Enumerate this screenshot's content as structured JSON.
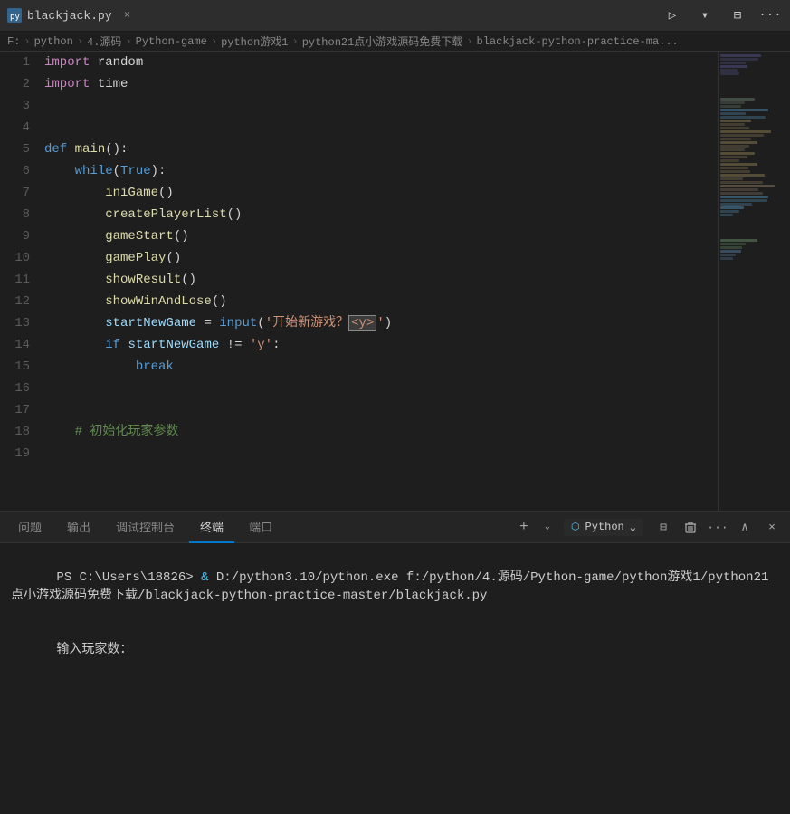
{
  "titleBar": {
    "tabName": "blackjack.py",
    "closeLabel": "×",
    "runBtn": "▷",
    "runDropdown": "▾",
    "splitBtn": "⊟",
    "moreBtn": "···"
  },
  "breadcrumb": {
    "parts": [
      "F:",
      "python",
      "4.源码",
      "Python-game",
      "python游戏1",
      "python21点小游戏源码免费下载",
      "blackjack-python-practice-ma..."
    ]
  },
  "codeLines": [
    {
      "num": "1",
      "tokens": [
        {
          "t": "kw",
          "v": "import"
        },
        {
          "t": "plain",
          "v": " random"
        }
      ]
    },
    {
      "num": "2",
      "tokens": [
        {
          "t": "kw",
          "v": "import"
        },
        {
          "t": "plain",
          "v": " time"
        }
      ]
    },
    {
      "num": "3",
      "tokens": []
    },
    {
      "num": "4",
      "tokens": []
    },
    {
      "num": "5",
      "tokens": [
        {
          "t": "kw-blue",
          "v": "def"
        },
        {
          "t": "plain",
          "v": " "
        },
        {
          "t": "fn",
          "v": "main"
        },
        {
          "t": "plain",
          "v": "():"
        }
      ]
    },
    {
      "num": "6",
      "tokens": [
        {
          "t": "plain",
          "v": "    "
        },
        {
          "t": "kw-blue",
          "v": "while"
        },
        {
          "t": "plain",
          "v": "("
        },
        {
          "t": "true-kw",
          "v": "True"
        },
        {
          "t": "plain",
          "v": "):"
        }
      ]
    },
    {
      "num": "7",
      "tokens": [
        {
          "t": "plain",
          "v": "        "
        },
        {
          "t": "fn",
          "v": "iniGame"
        },
        {
          "t": "plain",
          "v": "()"
        }
      ]
    },
    {
      "num": "8",
      "tokens": [
        {
          "t": "plain",
          "v": "        "
        },
        {
          "t": "fn",
          "v": "createPlayerList"
        },
        {
          "t": "plain",
          "v": "()"
        }
      ]
    },
    {
      "num": "9",
      "tokens": [
        {
          "t": "plain",
          "v": "        "
        },
        {
          "t": "fn",
          "v": "gameStart"
        },
        {
          "t": "plain",
          "v": "()"
        }
      ]
    },
    {
      "num": "10",
      "tokens": [
        {
          "t": "plain",
          "v": "        "
        },
        {
          "t": "fn",
          "v": "gamePlay"
        },
        {
          "t": "plain",
          "v": "()"
        }
      ]
    },
    {
      "num": "11",
      "tokens": [
        {
          "t": "plain",
          "v": "        "
        },
        {
          "t": "fn",
          "v": "showResult"
        },
        {
          "t": "plain",
          "v": "()"
        }
      ]
    },
    {
      "num": "12",
      "tokens": [
        {
          "t": "plain",
          "v": "        "
        },
        {
          "t": "fn",
          "v": "showWinAndLose"
        },
        {
          "t": "plain",
          "v": "()"
        }
      ]
    },
    {
      "num": "13",
      "tokens": [
        {
          "t": "plain",
          "v": "        "
        },
        {
          "t": "param",
          "v": "startNewGame"
        },
        {
          "t": "plain",
          "v": " = "
        },
        {
          "t": "builtin",
          "v": "input"
        },
        {
          "t": "plain",
          "v": "("
        },
        {
          "t": "str",
          "v": "'开始新游戏？"
        },
        {
          "t": "input-hl",
          "v": "<y>"
        },
        {
          "t": "str",
          "v": "'"
        },
        {
          "t": "plain",
          "v": ")"
        }
      ]
    },
    {
      "num": "14",
      "tokens": [
        {
          "t": "plain",
          "v": "        "
        },
        {
          "t": "kw-blue",
          "v": "if"
        },
        {
          "t": "plain",
          "v": " "
        },
        {
          "t": "param",
          "v": "startNewGame"
        },
        {
          "t": "plain",
          "v": " != "
        },
        {
          "t": "str",
          "v": "'y'"
        },
        {
          "t": "plain",
          "v": ":"
        }
      ]
    },
    {
      "num": "15",
      "tokens": [
        {
          "t": "plain",
          "v": "            "
        },
        {
          "t": "kw-blue",
          "v": "break"
        }
      ]
    },
    {
      "num": "16",
      "tokens": []
    },
    {
      "num": "17",
      "tokens": []
    },
    {
      "num": "18",
      "tokens": [
        {
          "t": "plain",
          "v": "    "
        },
        {
          "t": "comment",
          "v": "# 初始化玩家参数"
        }
      ]
    },
    {
      "num": "19",
      "tokens": [
        {
          "t": "plain",
          "v": "    "
        }
      ]
    }
  ],
  "panelTabs": [
    {
      "label": "问题",
      "active": false
    },
    {
      "label": "输出",
      "active": false
    },
    {
      "label": "调试控制台",
      "active": false
    },
    {
      "label": "终端",
      "active": true
    },
    {
      "label": "端口",
      "active": false
    }
  ],
  "panelActions": {
    "addBtn": "+",
    "pythonLabel": "Python",
    "splitBtn": "⊟",
    "trashBtn": "🗑",
    "moreBtn": "···",
    "upBtn": "∧",
    "closeBtn": "×"
  },
  "terminalLines": [
    {
      "type": "command",
      "text": "PS C:\\Users\\18826> & D:/python3.10/python.exe f:/python/4.源码/Python-game/python游戏1/python21点小游戏源码免费下载/blackjack-python-practice-master/blackjack.py"
    },
    {
      "type": "output",
      "text": "输入玩家数："
    }
  ],
  "minimapLines": [
    {
      "color": "#4a4a7a",
      "width": "60%"
    },
    {
      "color": "#4a4a7a",
      "width": "40%"
    },
    {
      "color": "transparent",
      "width": "0%"
    },
    {
      "color": "transparent",
      "width": "0%"
    },
    {
      "color": "#5a6a5a",
      "width": "50%"
    },
    {
      "color": "#4a7a9a",
      "width": "70%"
    },
    {
      "color": "#7a6a4a",
      "width": "45%"
    },
    {
      "color": "#7a6a4a",
      "width": "75%"
    },
    {
      "color": "#7a6a4a",
      "width": "55%"
    },
    {
      "color": "#7a6a4a",
      "width": "50%"
    },
    {
      "color": "#7a6a4a",
      "width": "55%"
    },
    {
      "color": "#7a6a4a",
      "width": "65%"
    },
    {
      "color": "#7a6a5a",
      "width": "80%"
    },
    {
      "color": "#4a7a9a",
      "width": "70%"
    },
    {
      "color": "#4a7a9a",
      "width": "35%"
    },
    {
      "color": "transparent",
      "width": "0%"
    },
    {
      "color": "transparent",
      "width": "0%"
    },
    {
      "color": "#5a7a5a",
      "width": "55%"
    },
    {
      "color": "#4a6a8a",
      "width": "30%"
    }
  ]
}
